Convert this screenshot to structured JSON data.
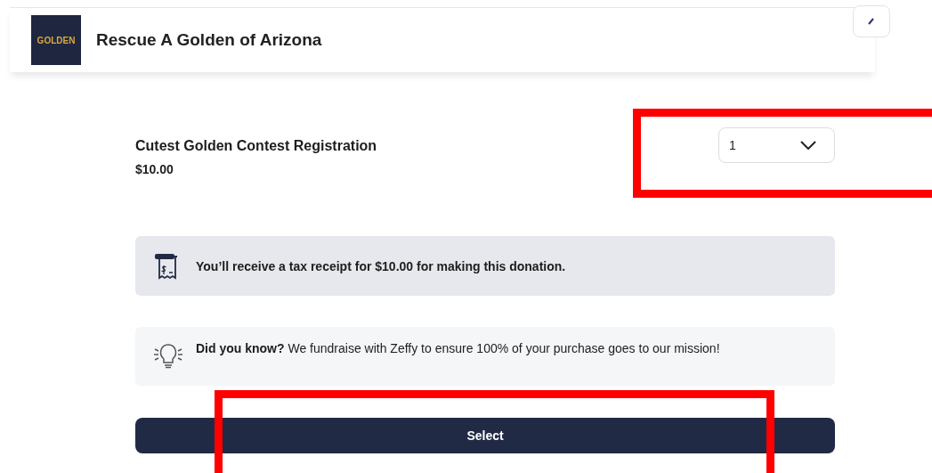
{
  "header": {
    "logo_text": "GOLDEN",
    "title": "Rescue A Golden of Arizona"
  },
  "item": {
    "name": "Cutest Golden Contest Registration",
    "price": "$10.00",
    "quantity": "1",
    "quantity_highlighted": true
  },
  "notices": [
    {
      "kind": "receipt",
      "text": "You’ll receive a tax receipt for $10.00 for making this donation."
    },
    {
      "kind": "tip",
      "text": "**Did you know?** We fundraise with Zeffy to ensure 100% of your purchase goes to our mission!"
    }
  ],
  "select_button": {
    "label": "Select",
    "highlighted": true
  }
}
